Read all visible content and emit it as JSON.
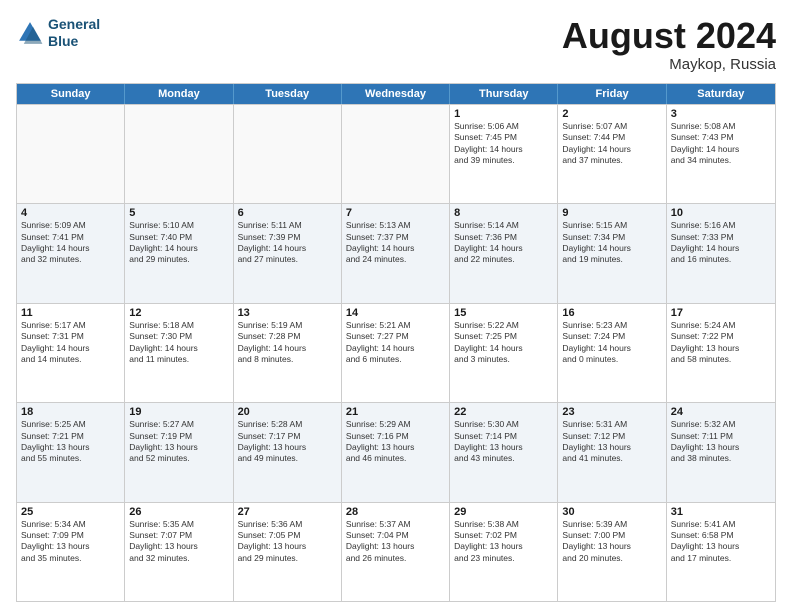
{
  "header": {
    "logo_line1": "General",
    "logo_line2": "Blue",
    "title": "August 2024",
    "location": "Maykop, Russia"
  },
  "days_of_week": [
    "Sunday",
    "Monday",
    "Tuesday",
    "Wednesday",
    "Thursday",
    "Friday",
    "Saturday"
  ],
  "weeks": [
    [
      {
        "num": "",
        "info": ""
      },
      {
        "num": "",
        "info": ""
      },
      {
        "num": "",
        "info": ""
      },
      {
        "num": "",
        "info": ""
      },
      {
        "num": "1",
        "info": "Sunrise: 5:06 AM\nSunset: 7:45 PM\nDaylight: 14 hours\nand 39 minutes."
      },
      {
        "num": "2",
        "info": "Sunrise: 5:07 AM\nSunset: 7:44 PM\nDaylight: 14 hours\nand 37 minutes."
      },
      {
        "num": "3",
        "info": "Sunrise: 5:08 AM\nSunset: 7:43 PM\nDaylight: 14 hours\nand 34 minutes."
      }
    ],
    [
      {
        "num": "4",
        "info": "Sunrise: 5:09 AM\nSunset: 7:41 PM\nDaylight: 14 hours\nand 32 minutes."
      },
      {
        "num": "5",
        "info": "Sunrise: 5:10 AM\nSunset: 7:40 PM\nDaylight: 14 hours\nand 29 minutes."
      },
      {
        "num": "6",
        "info": "Sunrise: 5:11 AM\nSunset: 7:39 PM\nDaylight: 14 hours\nand 27 minutes."
      },
      {
        "num": "7",
        "info": "Sunrise: 5:13 AM\nSunset: 7:37 PM\nDaylight: 14 hours\nand 24 minutes."
      },
      {
        "num": "8",
        "info": "Sunrise: 5:14 AM\nSunset: 7:36 PM\nDaylight: 14 hours\nand 22 minutes."
      },
      {
        "num": "9",
        "info": "Sunrise: 5:15 AM\nSunset: 7:34 PM\nDaylight: 14 hours\nand 19 minutes."
      },
      {
        "num": "10",
        "info": "Sunrise: 5:16 AM\nSunset: 7:33 PM\nDaylight: 14 hours\nand 16 minutes."
      }
    ],
    [
      {
        "num": "11",
        "info": "Sunrise: 5:17 AM\nSunset: 7:31 PM\nDaylight: 14 hours\nand 14 minutes."
      },
      {
        "num": "12",
        "info": "Sunrise: 5:18 AM\nSunset: 7:30 PM\nDaylight: 14 hours\nand 11 minutes."
      },
      {
        "num": "13",
        "info": "Sunrise: 5:19 AM\nSunset: 7:28 PM\nDaylight: 14 hours\nand 8 minutes."
      },
      {
        "num": "14",
        "info": "Sunrise: 5:21 AM\nSunset: 7:27 PM\nDaylight: 14 hours\nand 6 minutes."
      },
      {
        "num": "15",
        "info": "Sunrise: 5:22 AM\nSunset: 7:25 PM\nDaylight: 14 hours\nand 3 minutes."
      },
      {
        "num": "16",
        "info": "Sunrise: 5:23 AM\nSunset: 7:24 PM\nDaylight: 14 hours\nand 0 minutes."
      },
      {
        "num": "17",
        "info": "Sunrise: 5:24 AM\nSunset: 7:22 PM\nDaylight: 13 hours\nand 58 minutes."
      }
    ],
    [
      {
        "num": "18",
        "info": "Sunrise: 5:25 AM\nSunset: 7:21 PM\nDaylight: 13 hours\nand 55 minutes."
      },
      {
        "num": "19",
        "info": "Sunrise: 5:27 AM\nSunset: 7:19 PM\nDaylight: 13 hours\nand 52 minutes."
      },
      {
        "num": "20",
        "info": "Sunrise: 5:28 AM\nSunset: 7:17 PM\nDaylight: 13 hours\nand 49 minutes."
      },
      {
        "num": "21",
        "info": "Sunrise: 5:29 AM\nSunset: 7:16 PM\nDaylight: 13 hours\nand 46 minutes."
      },
      {
        "num": "22",
        "info": "Sunrise: 5:30 AM\nSunset: 7:14 PM\nDaylight: 13 hours\nand 43 minutes."
      },
      {
        "num": "23",
        "info": "Sunrise: 5:31 AM\nSunset: 7:12 PM\nDaylight: 13 hours\nand 41 minutes."
      },
      {
        "num": "24",
        "info": "Sunrise: 5:32 AM\nSunset: 7:11 PM\nDaylight: 13 hours\nand 38 minutes."
      }
    ],
    [
      {
        "num": "25",
        "info": "Sunrise: 5:34 AM\nSunset: 7:09 PM\nDaylight: 13 hours\nand 35 minutes."
      },
      {
        "num": "26",
        "info": "Sunrise: 5:35 AM\nSunset: 7:07 PM\nDaylight: 13 hours\nand 32 minutes."
      },
      {
        "num": "27",
        "info": "Sunrise: 5:36 AM\nSunset: 7:05 PM\nDaylight: 13 hours\nand 29 minutes."
      },
      {
        "num": "28",
        "info": "Sunrise: 5:37 AM\nSunset: 7:04 PM\nDaylight: 13 hours\nand 26 minutes."
      },
      {
        "num": "29",
        "info": "Sunrise: 5:38 AM\nSunset: 7:02 PM\nDaylight: 13 hours\nand 23 minutes."
      },
      {
        "num": "30",
        "info": "Sunrise: 5:39 AM\nSunset: 7:00 PM\nDaylight: 13 hours\nand 20 minutes."
      },
      {
        "num": "31",
        "info": "Sunrise: 5:41 AM\nSunset: 6:58 PM\nDaylight: 13 hours\nand 17 minutes."
      }
    ]
  ]
}
